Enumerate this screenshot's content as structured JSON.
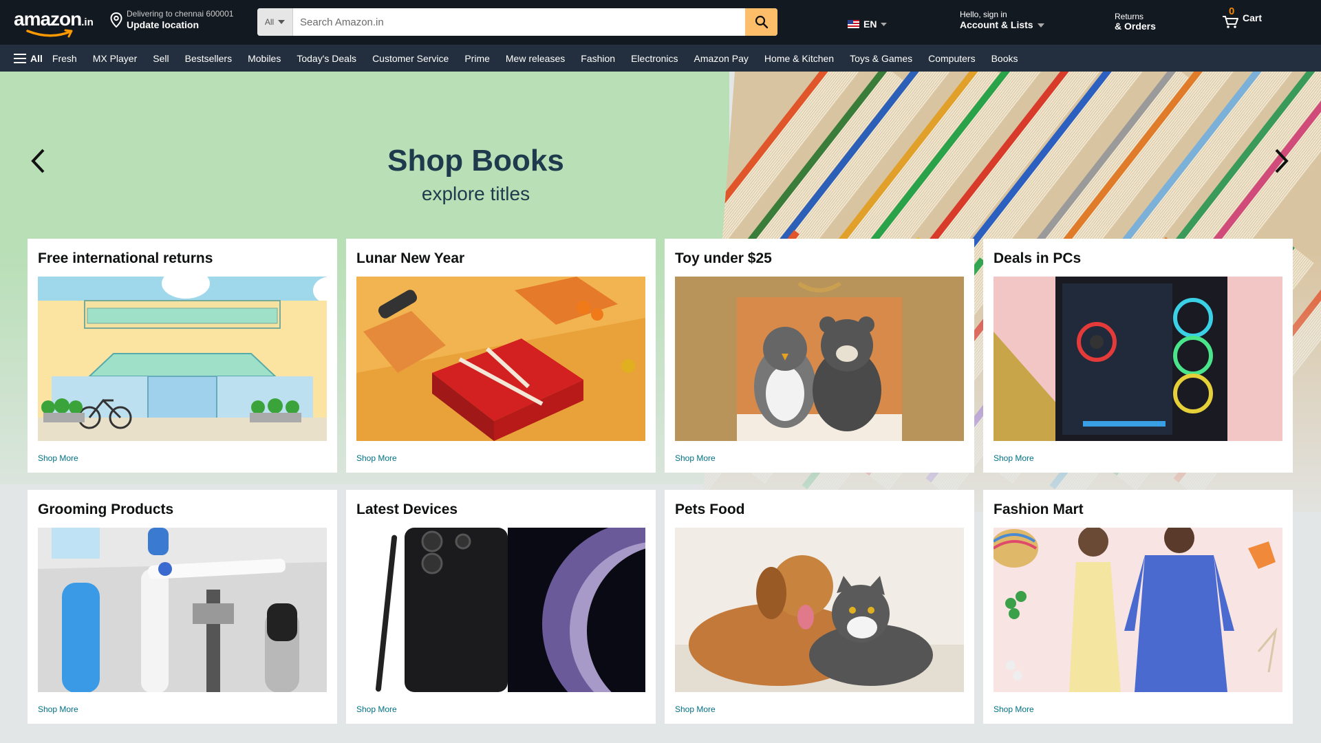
{
  "header": {
    "logo_text": "amazon",
    "logo_suffix": ".in",
    "deliver_line1": "Delivering to chennai 600001",
    "deliver_line2": "Update location",
    "search_category": "All",
    "search_placeholder": "Search Amazon.in",
    "language": "EN",
    "account_line1": "Hello, sign in",
    "account_line2": "Account & Lists",
    "returns_line1": "Returns",
    "returns_line2": "& Orders",
    "cart_count": "0",
    "cart_label": "Cart"
  },
  "nav": {
    "all_label": "All",
    "items": [
      "Fresh",
      "MX Player",
      "Sell",
      "Bestsellers",
      "Mobiles",
      "Today's Deals",
      "Customer Service",
      "Prime",
      "Mew releases",
      "Fashion",
      "Electronics",
      "Amazon Pay",
      "Home & Kitchen",
      "Toys & Games",
      "Computers",
      "Books"
    ]
  },
  "hero": {
    "title": "Shop Books",
    "subtitle": "explore titles"
  },
  "cards": [
    {
      "title": "Free international returns",
      "link": "Shop More",
      "image": "storefront-illustration"
    },
    {
      "title": "Lunar New Year",
      "link": "Shop More",
      "image": "red-gift-box"
    },
    {
      "title": "Toy under $25",
      "link": "Shop More",
      "image": "plush-toys"
    },
    {
      "title": "Deals in PCs",
      "link": "Shop More",
      "image": "gaming-pc"
    },
    {
      "title": "Grooming Products",
      "link": "Shop More",
      "image": "grooming-items"
    },
    {
      "title": "Latest Devices",
      "link": "Shop More",
      "image": "smartphone"
    },
    {
      "title": "Pets Food",
      "link": "Shop More",
      "image": "dog-and-cat"
    },
    {
      "title": "Fashion Mart",
      "link": "Shop More",
      "image": "fashion-models"
    }
  ],
  "colors": {
    "header_bg": "#131921",
    "nav_bg": "#232f3e",
    "search_button": "#febd69",
    "hero_bg": "#b8dfb6",
    "link": "#007185",
    "cart_count": "#f08804"
  }
}
